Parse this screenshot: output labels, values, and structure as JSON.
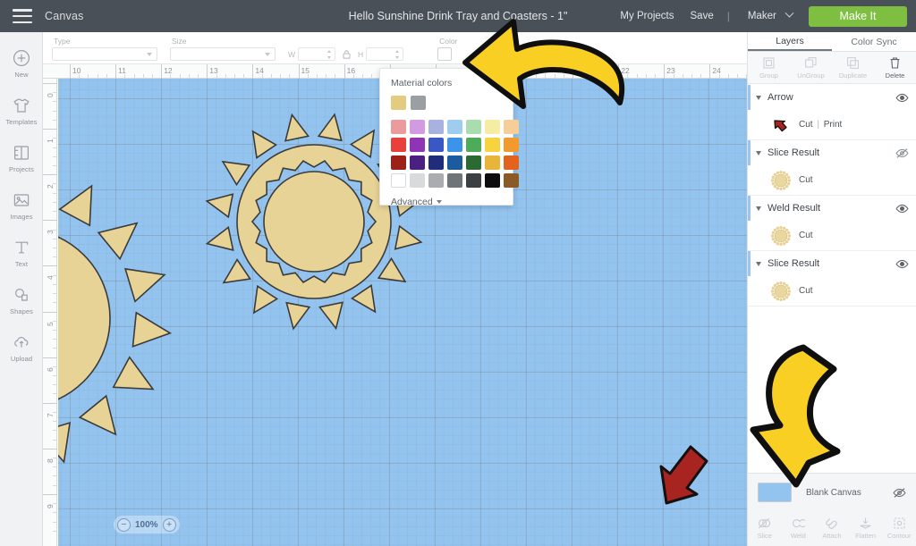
{
  "header": {
    "menu_icon": "hamburger-icon",
    "canvas_label": "Canvas",
    "title": "Hello Sunshine Drink Tray and Coasters - 1\"",
    "my_projects": "My Projects",
    "save": "Save",
    "separator": "|",
    "machine": "Maker",
    "make_it": "Make It"
  },
  "sidebar": {
    "items": [
      {
        "label": "New",
        "icon": "plus-circle-icon"
      },
      {
        "label": "Templates",
        "icon": "tshirt-icon"
      },
      {
        "label": "Projects",
        "icon": "projects-icon"
      },
      {
        "label": "Images",
        "icon": "image-icon"
      },
      {
        "label": "Text",
        "icon": "text-icon"
      },
      {
        "label": "Shapes",
        "icon": "shapes-icon"
      },
      {
        "label": "Upload",
        "icon": "upload-cloud-icon"
      }
    ]
  },
  "toolbar": {
    "type_label": "Type",
    "type_value": "",
    "size_label": "Size",
    "size_value": "",
    "w_label": "W",
    "w_value": "",
    "h_label": "H",
    "h_value": "",
    "lock_icon": "lock-icon",
    "color_label": "Color",
    "color_value": "#ffffff"
  },
  "color_popover": {
    "title": "Material colors",
    "recent": [
      "#e3cc82",
      "#9a9fa3"
    ],
    "grid": [
      [
        "#eb9b9b",
        "#d29ae0",
        "#a8b2e0",
        "#9fcdf0",
        "#a9dcae",
        "#f6eda4",
        "#f5cf97"
      ],
      [
        "#e8413c",
        "#8e34b5",
        "#3a57c4",
        "#3d93e8",
        "#4dab5a",
        "#f7d33f",
        "#f29a2e"
      ],
      [
        "#9e2119",
        "#4b2080",
        "#1f2d7a",
        "#1c5b9e",
        "#2b6b33",
        "#e8b53a",
        "#e2631d"
      ],
      [
        "#ffffff",
        "#d8dadc",
        "#a9adb1",
        "#6e7478",
        "#3b4045",
        "#0d0d0f",
        "#8a5a27"
      ]
    ],
    "advanced": "Advanced"
  },
  "canvas": {
    "ruler_h": [
      "10",
      "11",
      "12",
      "13",
      "14",
      "15",
      "16",
      "17",
      "18",
      "19",
      "20",
      "21",
      "22",
      "23",
      "24"
    ],
    "ruler_v": [
      "0",
      "1",
      "2",
      "3",
      "4",
      "5",
      "6",
      "7",
      "8",
      "9"
    ],
    "zoom_level": "100%",
    "zoom_out_icon": "minus-circle-icon",
    "zoom_in_icon": "plus-circle-icon",
    "background_color": "#93c4f0",
    "art_fill": "#e8d396",
    "art_stroke": "#3b3b3b",
    "arrow_fill": "#a82420"
  },
  "right_panel": {
    "tabs": [
      {
        "label": "Layers",
        "active": true
      },
      {
        "label": "Color Sync",
        "active": false
      }
    ],
    "actions": [
      {
        "label": "Group",
        "icon": "group-icon",
        "enabled": false
      },
      {
        "label": "UnGroup",
        "icon": "ungroup-icon",
        "enabled": false
      },
      {
        "label": "Duplicate",
        "icon": "duplicate-icon",
        "enabled": false
      },
      {
        "label": "Delete",
        "icon": "trash-icon",
        "enabled": true
      }
    ],
    "layers": [
      {
        "name": "Arrow",
        "operation": "Cut",
        "operation2": "Print",
        "divider": "|",
        "thumb": "arrow",
        "visible": true,
        "eye_icon": "eye-icon"
      },
      {
        "name": "Slice Result",
        "operation": "Cut",
        "operation2": "",
        "divider": "",
        "thumb": "sun",
        "visible": false,
        "eye_icon": "eye-off-icon"
      },
      {
        "name": "Weld Result",
        "operation": "Cut",
        "operation2": "",
        "divider": "",
        "thumb": "sun",
        "visible": true,
        "eye_icon": "eye-icon"
      },
      {
        "name": "Slice Result",
        "operation": "Cut",
        "operation2": "",
        "divider": "",
        "thumb": "sun",
        "visible": true,
        "eye_icon": "eye-icon"
      }
    ],
    "canvas_row": {
      "name": "Blank Canvas",
      "color": "#93c4f0",
      "eye_icon": "eye-off-icon"
    },
    "operations": [
      {
        "label": "Slice",
        "icon": "slice-icon"
      },
      {
        "label": "Weld",
        "icon": "weld-icon"
      },
      {
        "label": "Attach",
        "icon": "attach-icon"
      },
      {
        "label": "Flatten",
        "icon": "flatten-icon"
      },
      {
        "label": "Contour",
        "icon": "contour-icon"
      }
    ]
  },
  "annotations": [
    {
      "name": "yellow-arrow-pointing-left",
      "color": "#f8cf22"
    },
    {
      "name": "yellow-arrow-pointing-down",
      "color": "#f8cf22"
    }
  ]
}
